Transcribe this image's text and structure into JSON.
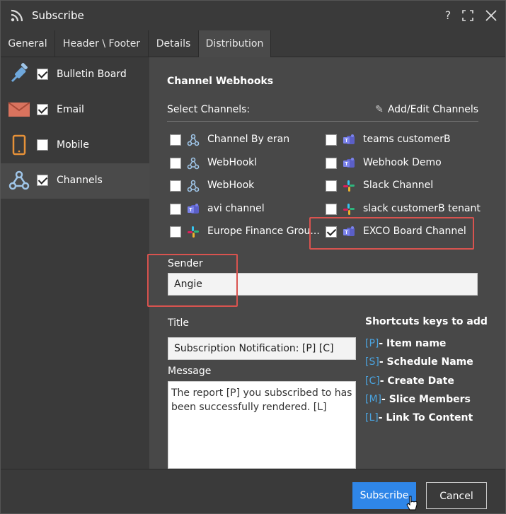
{
  "window": {
    "title": "Subscribe",
    "help_glyph": "?",
    "maximize_glyph": "⛶",
    "close_glyph": "✕"
  },
  "tabs": [
    {
      "label": "General",
      "active": false
    },
    {
      "label": "Header \\ Footer",
      "active": false
    },
    {
      "label": "Details",
      "active": false
    },
    {
      "label": "Distribution",
      "active": true
    }
  ],
  "sidebar": {
    "items": [
      {
        "label": "Bulletin Board",
        "icon": "pushpin-icon",
        "checked": true
      },
      {
        "label": "Email",
        "icon": "envelope-icon",
        "checked": true
      },
      {
        "label": "Mobile",
        "icon": "mobile-phone-icon",
        "checked": false
      },
      {
        "label": "Channels",
        "icon": "webhook-icon",
        "checked": true,
        "active": true
      }
    ]
  },
  "channels": {
    "section_title": "Channel Webhooks",
    "select_label": "Select Channels:",
    "add_edit_label": "Add/Edit Channels",
    "left": [
      {
        "label": "Channel By eran",
        "icon": "webhook-icon",
        "checked": false
      },
      {
        "label": "WebHookl",
        "icon": "webhook-icon",
        "checked": false
      },
      {
        "label": "WebHook",
        "icon": "webhook-icon",
        "checked": false
      },
      {
        "label": "avi channel",
        "icon": "teams-icon",
        "checked": false
      },
      {
        "label": "Europe Finance Grou...",
        "icon": "slack-icon",
        "checked": false
      }
    ],
    "right": [
      {
        "label": "teams customerB",
        "icon": "teams-icon",
        "checked": false
      },
      {
        "label": "Webhook Demo",
        "icon": "teams-icon",
        "checked": false
      },
      {
        "label": "Slack Channel",
        "icon": "slack-icon",
        "checked": false
      },
      {
        "label": "slack customerB tenant",
        "icon": "slack-icon",
        "checked": false
      },
      {
        "label": "EXCO Board Channel",
        "icon": "teams-icon",
        "checked": true
      }
    ]
  },
  "sender": {
    "label": "Sender",
    "value": "Angie"
  },
  "title_field": {
    "label": "Title",
    "value": "Subscription Notification: [P] [C]"
  },
  "message": {
    "label": "Message",
    "value": "The report [P] you subscribed to has been successfully rendered. [L]"
  },
  "shortcuts": {
    "title": "Shortcuts keys to add",
    "items": [
      {
        "key": "[P]",
        "text": "- Item name"
      },
      {
        "key": "[S]",
        "text": "- Schedule Name"
      },
      {
        "key": "[C]",
        "text": "- Create Date"
      },
      {
        "key": "[M]",
        "text": "- Slice Members"
      },
      {
        "key": "[L]",
        "text": "- Link To Content"
      }
    ]
  },
  "footer": {
    "subscribe_label": "Subscribe",
    "cancel_label": "Cancel"
  },
  "colors": {
    "accent": "#2f86e8",
    "highlight": "#d9534f",
    "shortcut_key": "#4aa3df"
  }
}
